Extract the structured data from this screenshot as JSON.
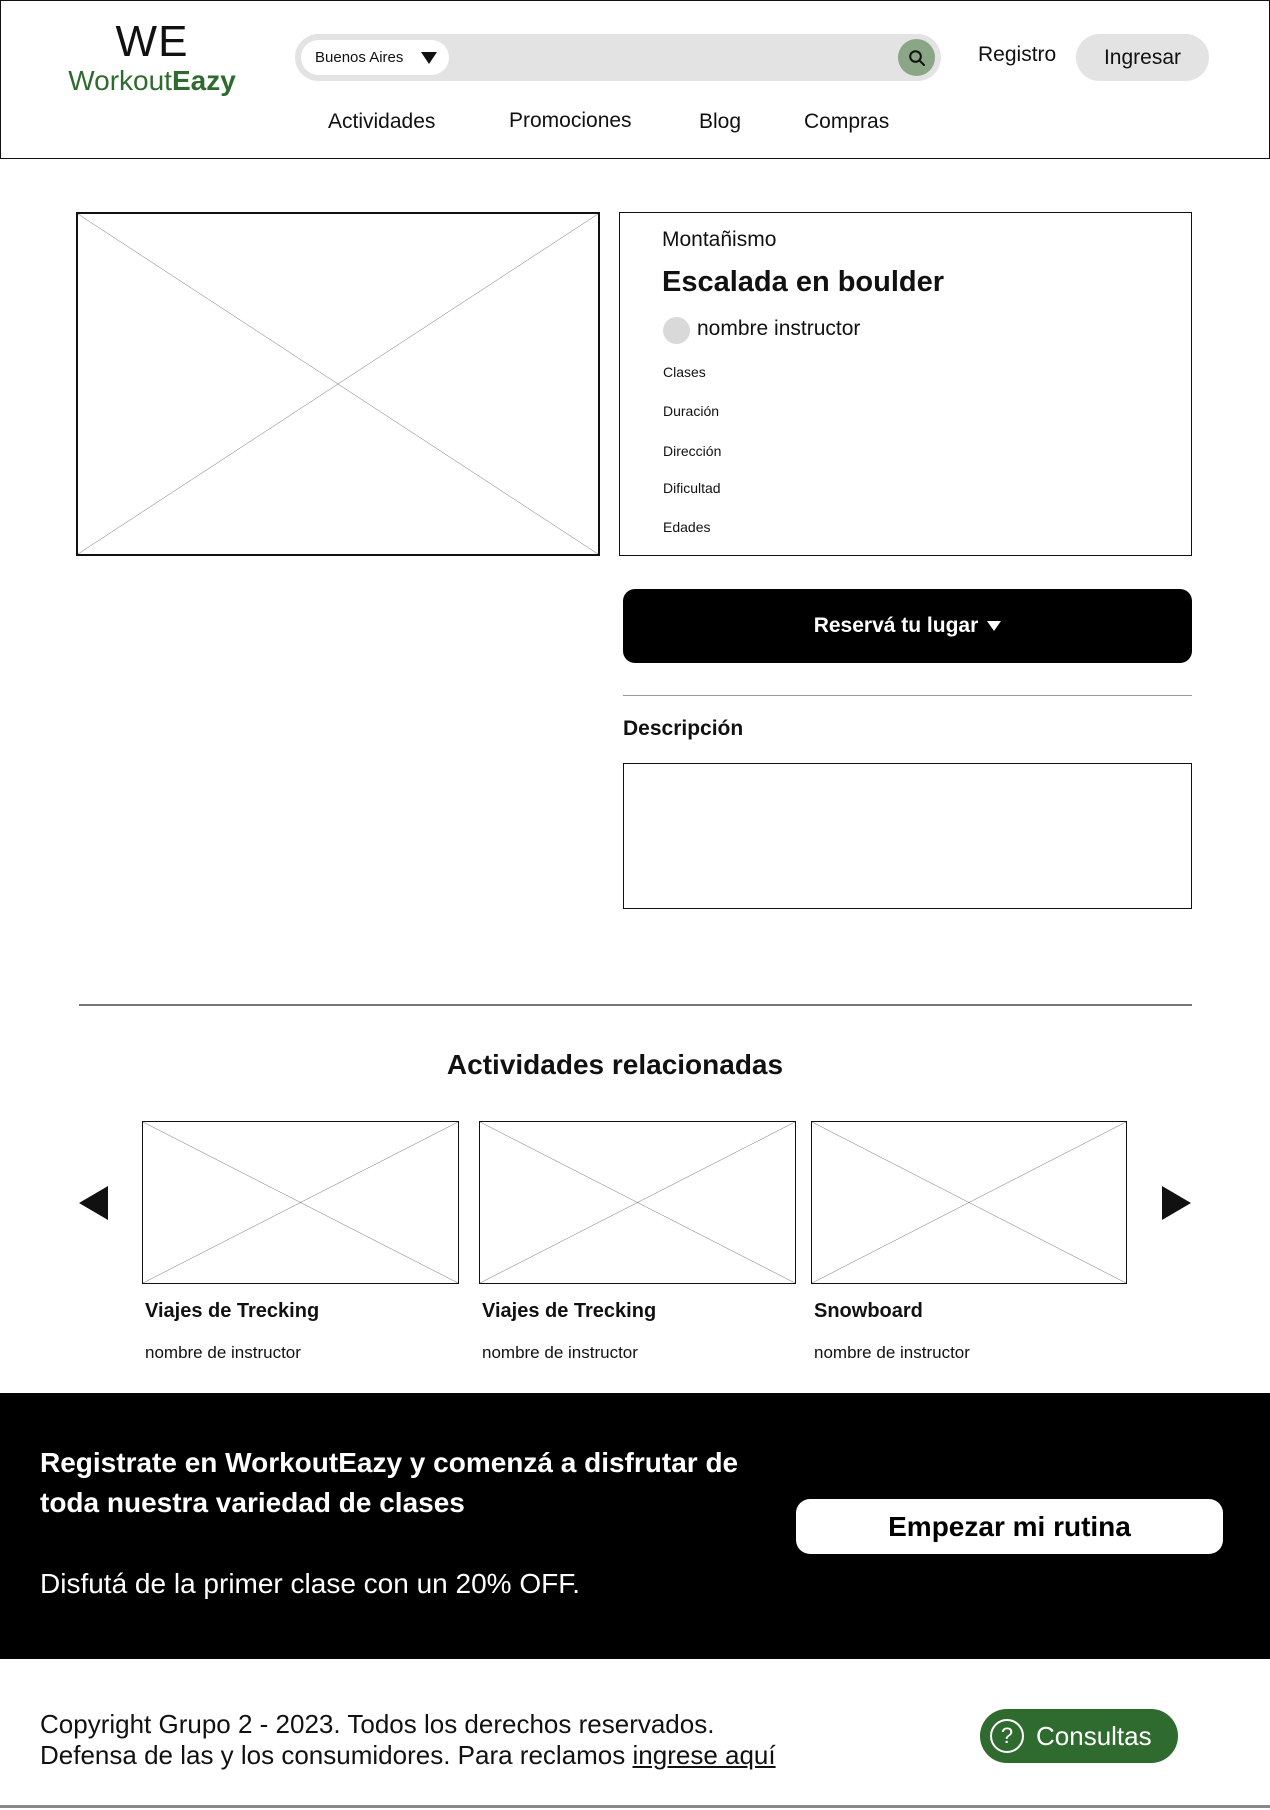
{
  "header": {
    "logo_top": "WE",
    "logo_word_light": "Workout",
    "logo_word_bold": "Eazy",
    "location": "Buenos Aires",
    "search_placeholder": "",
    "registro": "Registro",
    "ingresar": "Ingresar"
  },
  "nav": [
    "Actividades",
    "Promociones",
    "Blog",
    "Compras"
  ],
  "product": {
    "category": "Montañismo",
    "title": "Escalada en boulder",
    "instructor": "nombre instructor",
    "attributes": [
      "Clases",
      "Duración",
      "Dirección",
      "Dificultad",
      "Edades"
    ],
    "reserve_label": "Reservá tu lugar",
    "description_label": "Descripción",
    "description_text": ""
  },
  "related": {
    "title": "Actividades relacionadas",
    "items": [
      {
        "title": "Viajes de Trecking",
        "instructor": "nombre de instructor"
      },
      {
        "title": "Viajes de Trecking",
        "instructor": "nombre de instructor"
      },
      {
        "title": "Snowboard",
        "instructor": "nombre de instructor"
      }
    ]
  },
  "cta": {
    "heading": "Registrate en WorkoutEazy y comenzá a disfrutar de toda nuestra variedad de clases",
    "subtext": "Disfutá de la primer clase con un 20% OFF.",
    "button": "Empezar mi rutina"
  },
  "footer": {
    "copyright": "Copyright Grupo 2 - 2023. Todos los derechos reservados.",
    "defense_text": "Defensa de las y los consumidores. Para reclamos ",
    "defense_link": "ingrese aquí",
    "consultas": "Consultas"
  },
  "icons": {
    "search": "search-icon",
    "dropdown": "caret-down-icon",
    "prev": "arrow-left-icon",
    "next": "arrow-right-icon",
    "help": "question-icon"
  },
  "colors": {
    "brand_green": "#2f6b2e",
    "search_button": "#8aa686",
    "pill_gray": "#e3e3e3",
    "cta_background": "#000000"
  }
}
